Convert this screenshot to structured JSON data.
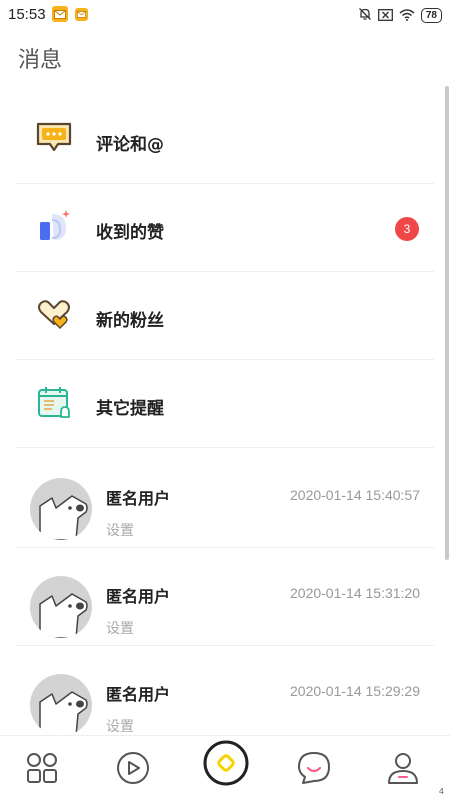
{
  "status_bar": {
    "time": "15:53",
    "battery": "78"
  },
  "header": {
    "title": "消息"
  },
  "menu": [
    {
      "label": "评论和@",
      "icon": "comment-bubble-icon",
      "badge": ""
    },
    {
      "label": "收到的赞",
      "icon": "like-thumb-icon",
      "badge": "3"
    },
    {
      "label": "新的粉丝",
      "icon": "heart-fans-icon",
      "badge": ""
    },
    {
      "label": "其它提醒",
      "icon": "calendar-bell-icon",
      "badge": ""
    }
  ],
  "conversations": [
    {
      "name": "匿名用户",
      "time": "2020-01-14 15:40:57",
      "preview": "设置"
    },
    {
      "name": "匿名用户",
      "time": "2020-01-14 15:31:20",
      "preview": "设置"
    },
    {
      "name": "匿名用户",
      "time": "2020-01-14 15:29:29",
      "preview": "设置"
    }
  ],
  "bottom_nav": [
    {
      "icon": "grid-icon"
    },
    {
      "icon": "play-icon"
    },
    {
      "icon": "home-center-icon"
    },
    {
      "icon": "chat-smile-icon"
    },
    {
      "icon": "profile-icon"
    }
  ],
  "page_indicator": "4",
  "colors": {
    "accent_yellow": "#f6b21a",
    "badge_red": "#f04848",
    "icon_brown": "#5a4630"
  }
}
